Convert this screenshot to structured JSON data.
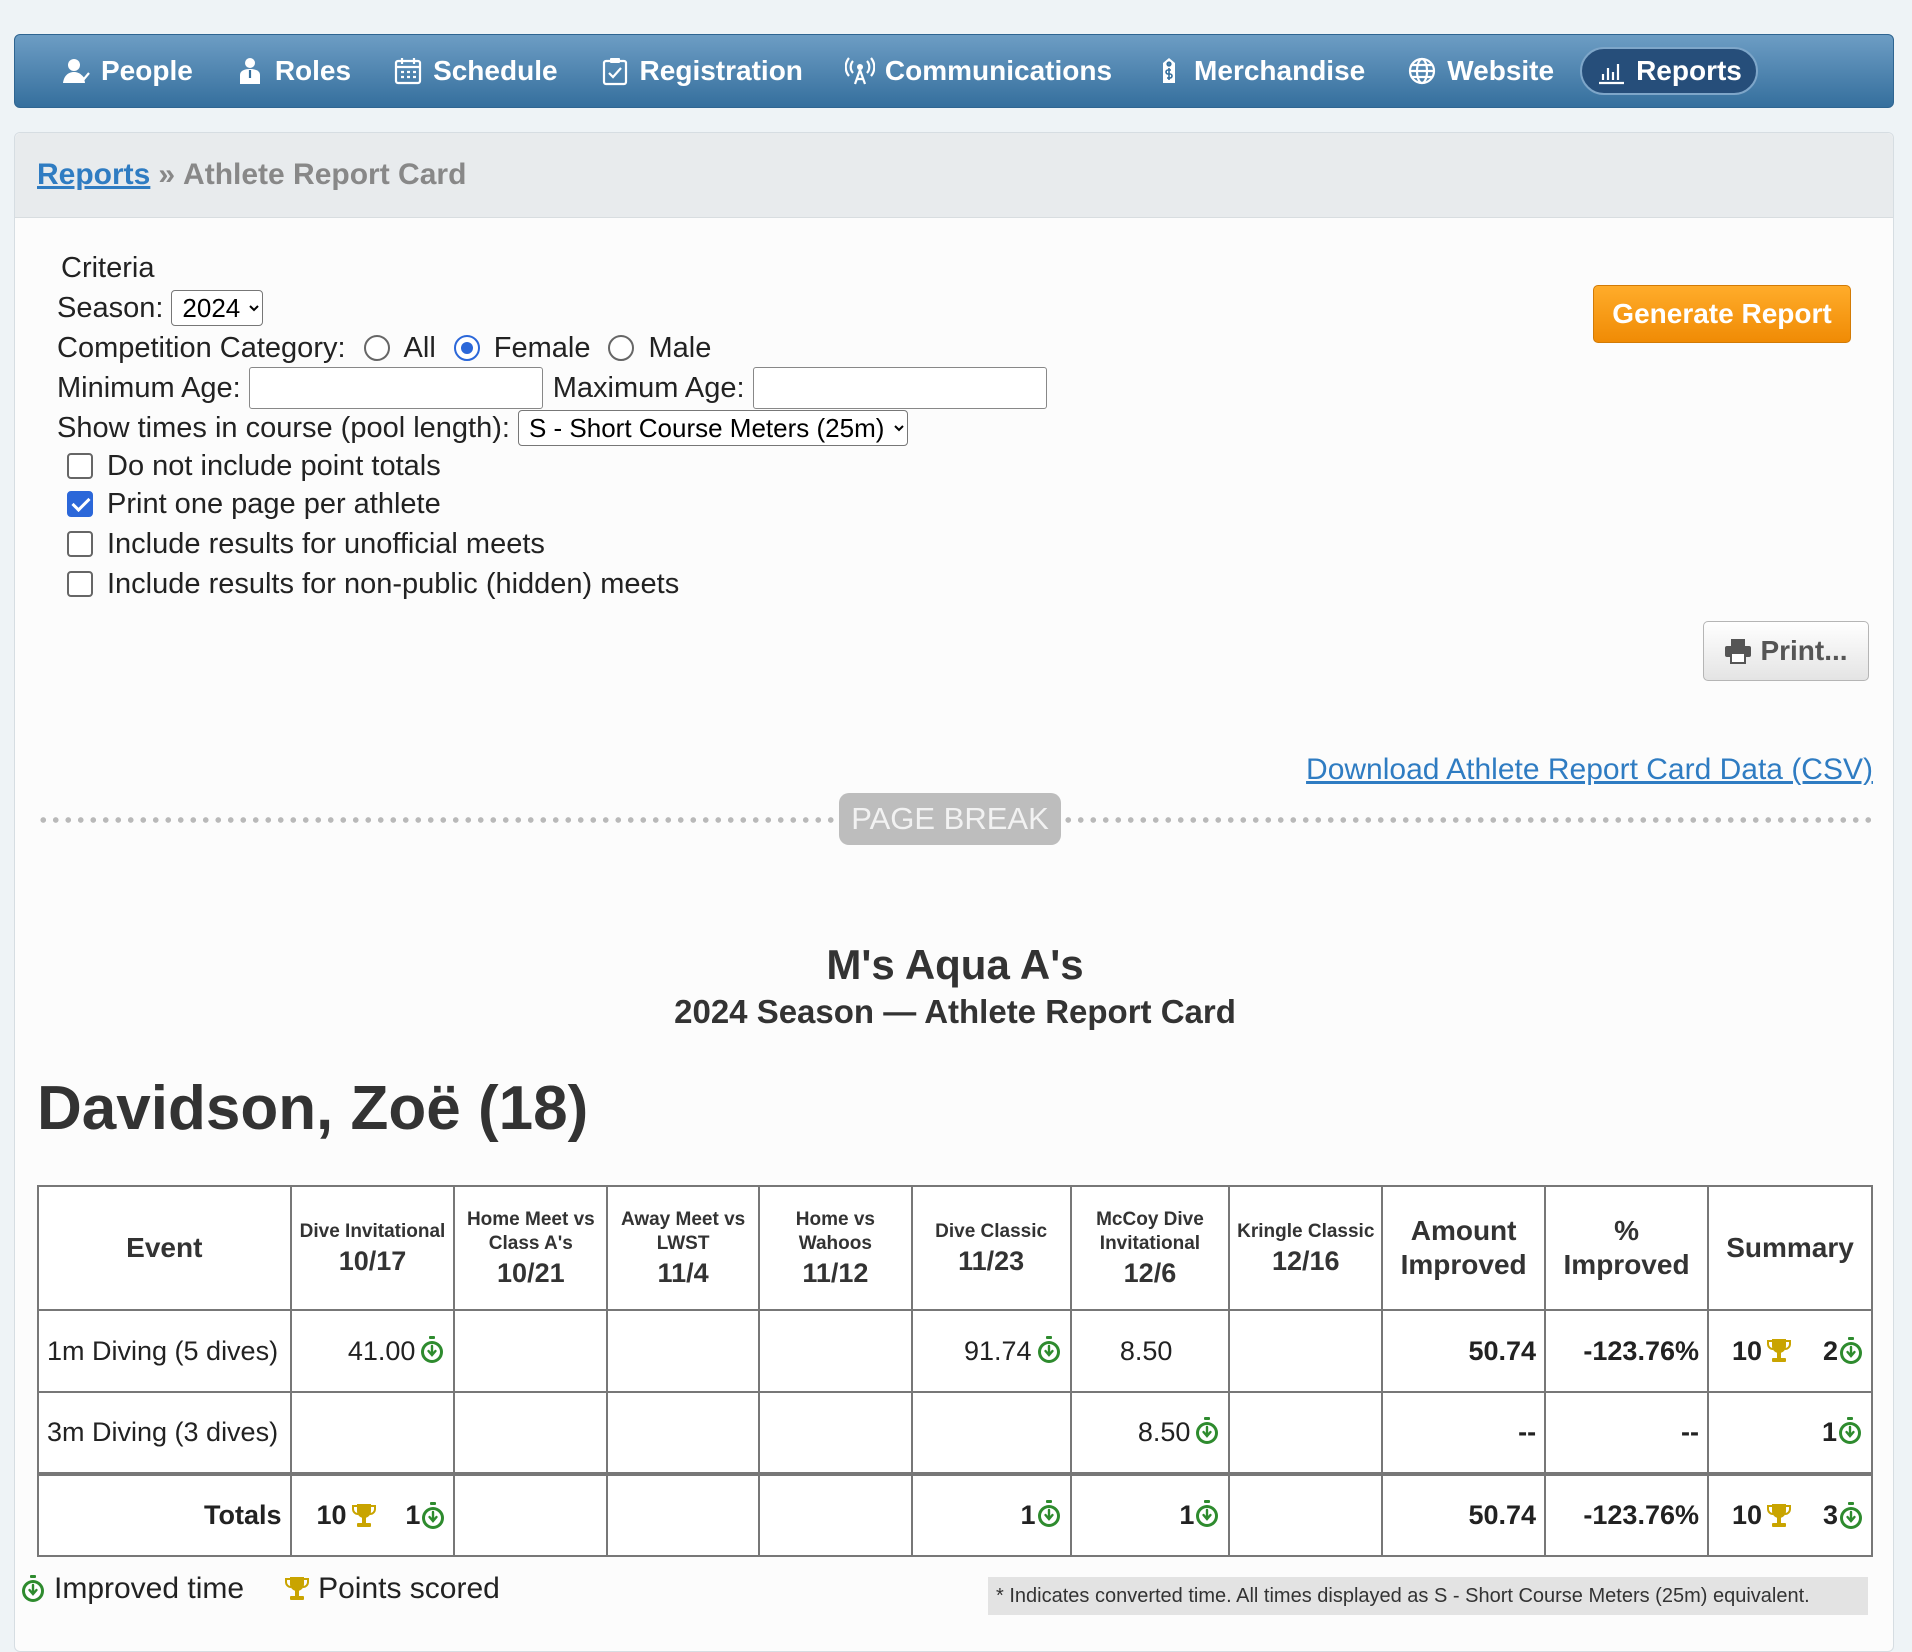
{
  "nav": {
    "items": [
      {
        "label": "People",
        "icon": "people-icon"
      },
      {
        "label": "Roles",
        "icon": "roles-icon"
      },
      {
        "label": "Schedule",
        "icon": "calendar-icon"
      },
      {
        "label": "Registration",
        "icon": "clipboard-icon"
      },
      {
        "label": "Communications",
        "icon": "antenna-icon"
      },
      {
        "label": "Merchandise",
        "icon": "price-tag-icon"
      },
      {
        "label": "Website",
        "icon": "globe-icon"
      },
      {
        "label": "Reports",
        "icon": "bar-chart-icon",
        "active": true
      }
    ]
  },
  "breadcrumb": {
    "parent": "Reports",
    "sep": "»",
    "current": "Athlete Report Card"
  },
  "criteria": {
    "heading": "Criteria",
    "season_label": "Season:",
    "season_value": "2024",
    "category_label": "Competition Category:",
    "category_options": [
      "All",
      "Female",
      "Male"
    ],
    "category_selected": "Female",
    "min_age_label": "Minimum Age:",
    "min_age_value": "",
    "max_age_label": "Maximum Age:",
    "max_age_value": "",
    "course_label": "Show times in course (pool length):",
    "course_value": "S - Short Course Meters (25m)",
    "checkboxes": [
      {
        "label": "Do not include point totals",
        "checked": false
      },
      {
        "label": "Print one page per athlete",
        "checked": true
      },
      {
        "label": "Include results for unofficial meets",
        "checked": false
      },
      {
        "label": "Include results for non-public (hidden) meets",
        "checked": false
      }
    ]
  },
  "buttons": {
    "generate": "Generate Report",
    "print": "Print..."
  },
  "csv_link": "Download Athlete Report Card Data (CSV)",
  "page_break": "PAGE BREAK",
  "report": {
    "org": "M's Aqua A's",
    "subtitle": "2024 Season — Athlete Report Card",
    "athlete": "Davidson, Zoë (18)",
    "headers": {
      "event": "Event",
      "meets": [
        {
          "name": "Dive Invitational",
          "date": "10/17"
        },
        {
          "name": "Home Meet vs Class A's",
          "date": "10/21"
        },
        {
          "name": "Away Meet vs LWST",
          "date": "11/4"
        },
        {
          "name": "Home vs Wahoos",
          "date": "11/12"
        },
        {
          "name": "Dive Classic",
          "date": "11/23"
        },
        {
          "name": "McCoy Dive Invitational",
          "date": "12/6"
        },
        {
          "name": "Kringle Classic",
          "date": "12/16"
        }
      ],
      "amount": "Amount Improved",
      "percent": "% Improved",
      "summary": "Summary"
    },
    "rows": [
      {
        "event": "1m Diving (5 dives)",
        "m1": "41.00",
        "m5": "91.74",
        "m6": "8.50",
        "amount": "50.74",
        "percent": "-123.76%",
        "sum_points": "10",
        "sum_improved": "2"
      },
      {
        "event": "3m Diving (3 dives)",
        "m6": "8.50",
        "amount": "--",
        "percent": "--",
        "sum_improved": "1"
      }
    ],
    "totals": {
      "label": "Totals",
      "m1_points": "10",
      "m1_improved": "1",
      "m5_improved": "1",
      "m6_improved": "1",
      "amount": "50.74",
      "percent": "-123.76%",
      "sum_points": "10",
      "sum_improved": "3"
    },
    "legend": {
      "improved": "Improved time",
      "points": "Points scored"
    },
    "footnote": "* Indicates converted time. All times displayed as S - Short Course Meters (25m) equivalent."
  },
  "colors": {
    "nav_gradient_top": "#6d9dc4",
    "nav_gradient_bottom": "#356f9d",
    "accent_orange": "#f5950f",
    "link_blue": "#2f7cc2",
    "improved_green": "#2e8b2e",
    "trophy_gold": "#c9a400"
  }
}
